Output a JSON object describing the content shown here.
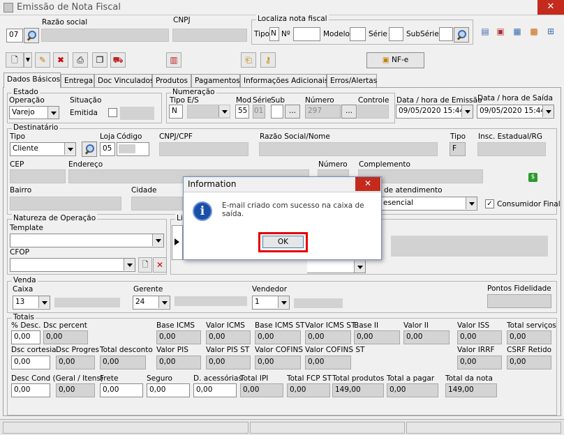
{
  "window": {
    "title": "Emissão de Nota Fiscal",
    "close": "✕"
  },
  "top": {
    "code_value": "07",
    "razao_label": "Razão social",
    "cnpj_label": "CNPJ",
    "localiza_title": "Localiza nota fiscal",
    "tipo_label": "Tipo",
    "tipo_value": "N",
    "no_label": "Nº",
    "modelo_label": "Modelo",
    "serie_label": "Série",
    "subserie_label": "SubSérie"
  },
  "toolbar": {
    "nfe_label": "NF-e"
  },
  "tabs": [
    "Dados Básicos",
    "Entrega",
    "Doc Vinculados",
    "Produtos",
    "Pagamentos",
    "Informações Adicionais",
    "Erros/Alertas"
  ],
  "estado": {
    "title": "Estado",
    "operacao_label": "Operação",
    "operacao_value": "Varejo",
    "situacao_label": "Situação",
    "situacao_value": "Emitida"
  },
  "numeracao": {
    "title": "Numeração",
    "tipo_label": "Tipo",
    "tipo_value": "N",
    "es_label": "E/S",
    "mod_label": "Mod",
    "mod_value": "55",
    "serie_label": "Série",
    "serie_value": "01",
    "sub_label": "Sub",
    "numero_label": "Número",
    "numero_value": "297",
    "controle_label": "Controle",
    "dots": "..."
  },
  "datas": {
    "emissao_label": "Data / hora de Emissão",
    "emissao_value": "09/05/2020 15:44",
    "saida_label": "Data / hora de Saída",
    "saida_value": "09/05/2020 15:44"
  },
  "destinatario": {
    "title": "Destinatário",
    "tipo_label": "Tipo",
    "tipo_value": "Cliente",
    "loja_label": "Loja",
    "loja_value": "05",
    "codigo_label": "Código",
    "cpf_label": "CNPJ/CPF",
    "razao_label": "Razão Social/Nome",
    "tipo2_label": "Tipo",
    "tipo2_value": "F",
    "insc_label": "Insc. Estadual/RG",
    "cep_label": "CEP",
    "endereco_label": "Endereço",
    "numero_label": "Número",
    "complemento_label": "Complemento",
    "bairro_label": "Bairro",
    "cidade_label": "Cidade",
    "atendimento_label": "de atendimento",
    "atendimento_value": "esencial",
    "consumidor_label": "Consumidor Final",
    "consumidor_check": "✓"
  },
  "natureza": {
    "title": "Natureza de Operação",
    "template_label": "Template",
    "cfop_label": "CFOP",
    "list_label": "Lis"
  },
  "venda": {
    "title": "Venda",
    "caixa_label": "Caixa",
    "caixa_value": "13",
    "gerente_label": "Gerente",
    "gerente_value": "24",
    "vendedor_label": "Vendedor",
    "vendedor_value": "1",
    "pontos_label": "Pontos Fidelidade"
  },
  "totais": {
    "title": "Totais",
    "fields": [
      {
        "label": "% Desc.",
        "value": "0,00"
      },
      {
        "label": "Dsc percent",
        "value": "0,00"
      },
      {
        "label": "Base ICMS",
        "value": "0,00"
      },
      {
        "label": "Valor ICMS",
        "value": "0,00"
      },
      {
        "label": "Base ICMS ST",
        "value": "0,00"
      },
      {
        "label": "Valor ICMS ST",
        "value": "0,00"
      },
      {
        "label": "Base II",
        "value": "0,00"
      },
      {
        "label": "Valor II",
        "value": "0,00"
      },
      {
        "label": "Valor ISS",
        "value": "0,00"
      },
      {
        "label": "Total serviços",
        "value": "0,00"
      },
      {
        "label": "Dsc cortesia",
        "value": "0,00"
      },
      {
        "label": "Dsc Progres",
        "value": "0,00"
      },
      {
        "label": "Total desconto",
        "value": "0,00"
      },
      {
        "label": "Valor PIS",
        "value": "0,00"
      },
      {
        "label": "Valor PIS ST",
        "value": "0,00"
      },
      {
        "label": "Valor COFINS",
        "value": "0,00"
      },
      {
        "label": "Valor COFINS ST",
        "value": "0,00"
      },
      {
        "label": "Valor IRRF",
        "value": "0,00"
      },
      {
        "label": "CSRF Retido",
        "value": "0,00"
      },
      {
        "label": "Desc Cond (Geral / Itens)",
        "value": "0,00"
      },
      {
        "label": "",
        "value": "0,00"
      },
      {
        "label": "Frete",
        "value": "0,00"
      },
      {
        "label": "Seguro",
        "value": "0,00"
      },
      {
        "label": "D. acessórias",
        "value": "0,00"
      },
      {
        "label": "Total IPI",
        "value": "0,00"
      },
      {
        "label": "Total FCP ST",
        "value": "0,00"
      },
      {
        "label": "Total produtos",
        "value": "149,00"
      },
      {
        "label": "Total a pagar",
        "value": "0,00"
      },
      {
        "label": "Total da nota",
        "value": "149,00"
      }
    ]
  },
  "dialog": {
    "title": "Information",
    "message": "E-mail criado com sucesso na caixa de saída.",
    "ok_label": "OK",
    "close": "✕",
    "icon_glyph": "i"
  },
  "colors": {
    "accent": "#e00000",
    "dialog_icon": "#1a4fa8",
    "close_red": "#c42b1c"
  }
}
